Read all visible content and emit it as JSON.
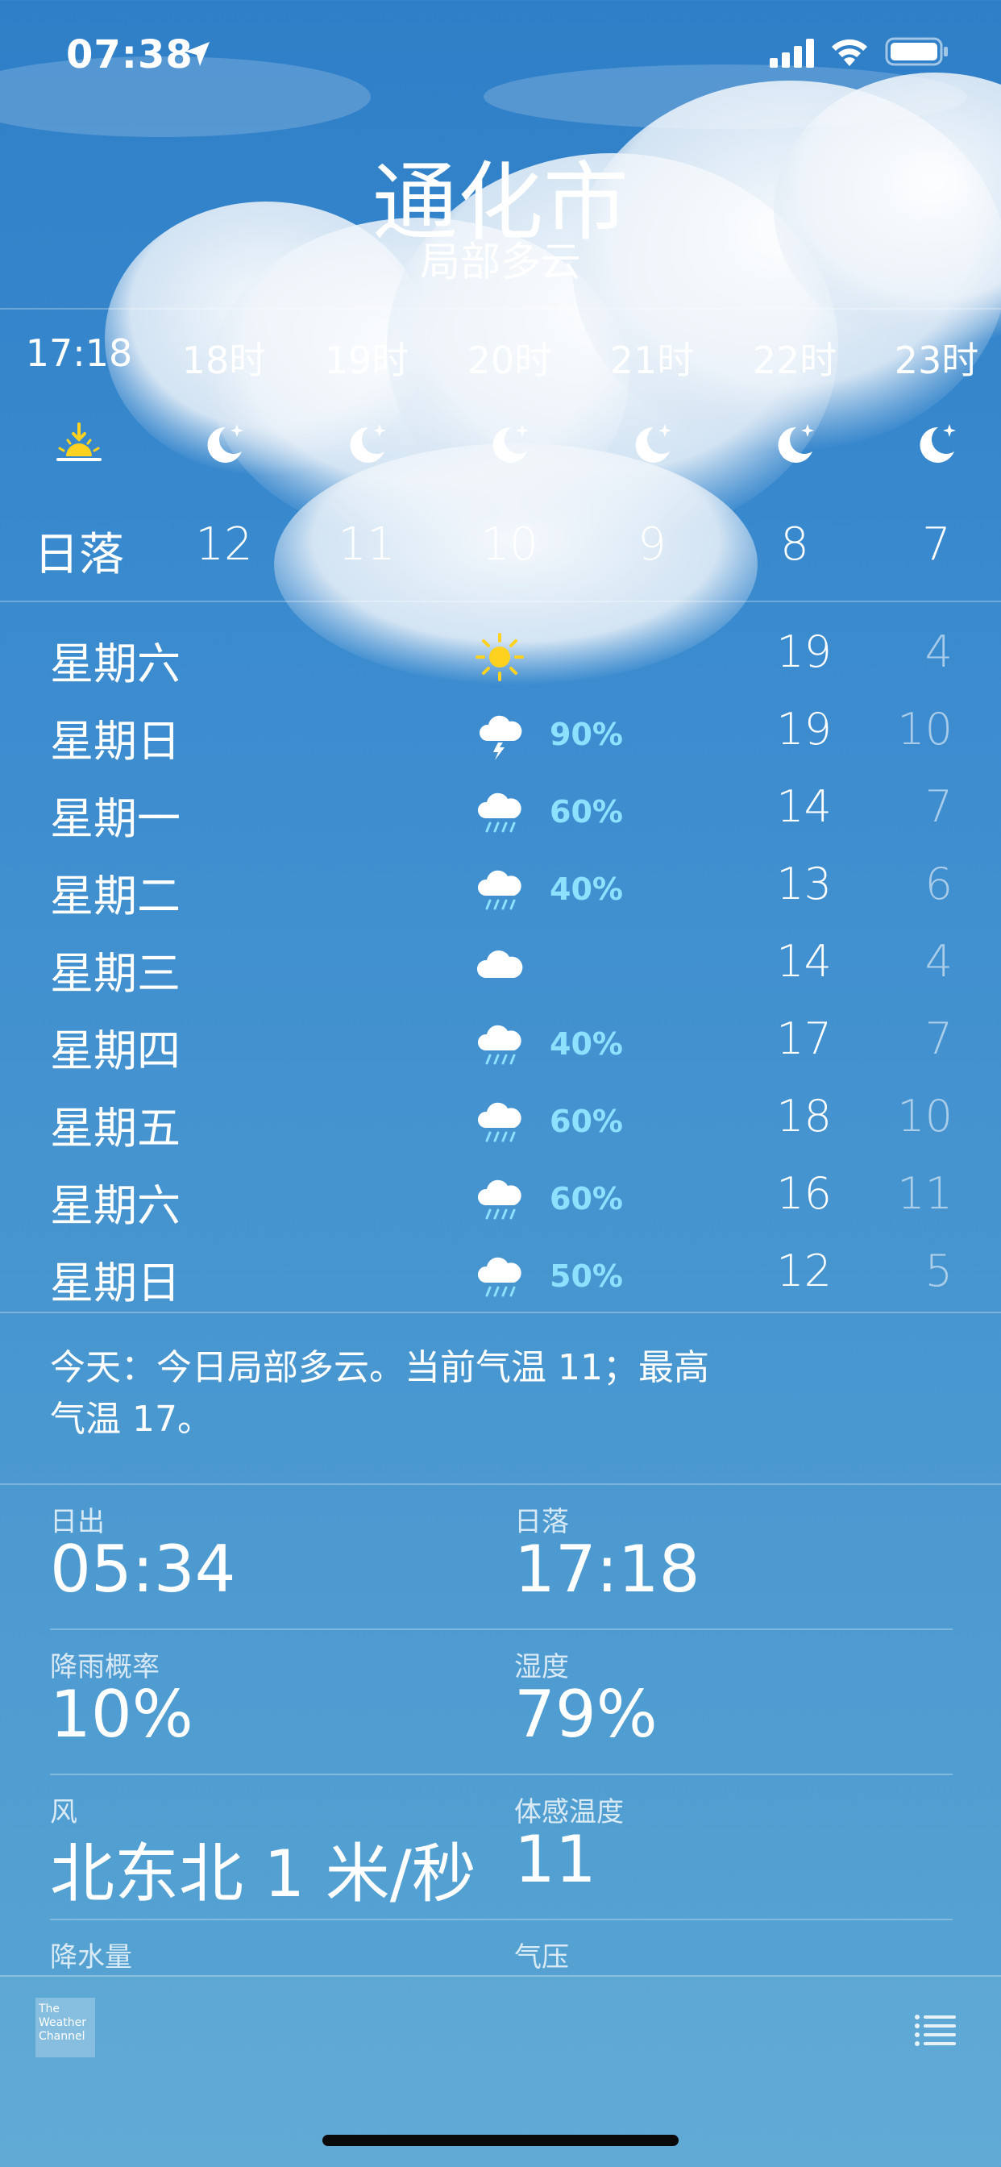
{
  "status_bar": {
    "time": "07:38",
    "location_icon": "location-arrow-icon",
    "signal_icon": "cellular-signal-icon",
    "wifi_icon": "wifi-icon",
    "battery_icon": "battery-icon"
  },
  "header": {
    "city": "通化市",
    "condition": "局部多云"
  },
  "hourly": [
    {
      "time": "17:18",
      "icon": "sunset-icon",
      "temp": "日落"
    },
    {
      "time": "18时",
      "icon": "moon-stars-icon",
      "temp": "12"
    },
    {
      "time": "19时",
      "icon": "moon-stars-icon",
      "temp": "11"
    },
    {
      "time": "20时",
      "icon": "moon-stars-icon",
      "temp": "10"
    },
    {
      "time": "21时",
      "icon": "moon-stars-icon",
      "temp": "9"
    },
    {
      "time": "22时",
      "icon": "moon-stars-icon",
      "temp": "8"
    },
    {
      "time": "23时",
      "icon": "moon-stars-icon",
      "temp": "7"
    }
  ],
  "daily": [
    {
      "day": "星期六",
      "icon": "sun-icon",
      "pop": "",
      "high": "19",
      "low": "4"
    },
    {
      "day": "星期日",
      "icon": "thunderstorm-icon",
      "pop": "90%",
      "high": "19",
      "low": "10"
    },
    {
      "day": "星期一",
      "icon": "rain-cloud-icon",
      "pop": "60%",
      "high": "14",
      "low": "7"
    },
    {
      "day": "星期二",
      "icon": "rain-cloud-icon",
      "pop": "40%",
      "high": "13",
      "low": "6"
    },
    {
      "day": "星期三",
      "icon": "cloud-icon",
      "pop": "",
      "high": "14",
      "low": "4"
    },
    {
      "day": "星期四",
      "icon": "rain-cloud-icon",
      "pop": "40%",
      "high": "17",
      "low": "7"
    },
    {
      "day": "星期五",
      "icon": "rain-cloud-icon",
      "pop": "60%",
      "high": "18",
      "low": "10"
    },
    {
      "day": "星期六",
      "icon": "rain-cloud-icon",
      "pop": "60%",
      "high": "16",
      "low": "11"
    },
    {
      "day": "星期日",
      "icon": "rain-cloud-icon",
      "pop": "50%",
      "high": "12",
      "low": "5"
    }
  ],
  "summary": {
    "line1": "今天：今日局部多云。当前气温 11；最高",
    "line2": "气温 17。"
  },
  "details": [
    {
      "label": "日出",
      "value": "05:34"
    },
    {
      "label": "日落",
      "value": "17:18"
    },
    {
      "label": "降雨概率",
      "value": "10%"
    },
    {
      "label": "湿度",
      "value": "79%"
    },
    {
      "label": "风",
      "value": "北东北 1 米/秒"
    },
    {
      "label": "体感温度",
      "value": "11"
    },
    {
      "label": "降水量",
      "value": ""
    },
    {
      "label": "气压",
      "value": ""
    }
  ],
  "footer": {
    "logo_text": [
      "The",
      "Weather",
      "Channel"
    ],
    "list_icon": "list-icon"
  },
  "colors": {
    "sky_top": "#2f7fc8",
    "sky_bottom": "#5aa6d3",
    "precip_accent": "#8ee0ff",
    "sun": "#ffd21f"
  }
}
